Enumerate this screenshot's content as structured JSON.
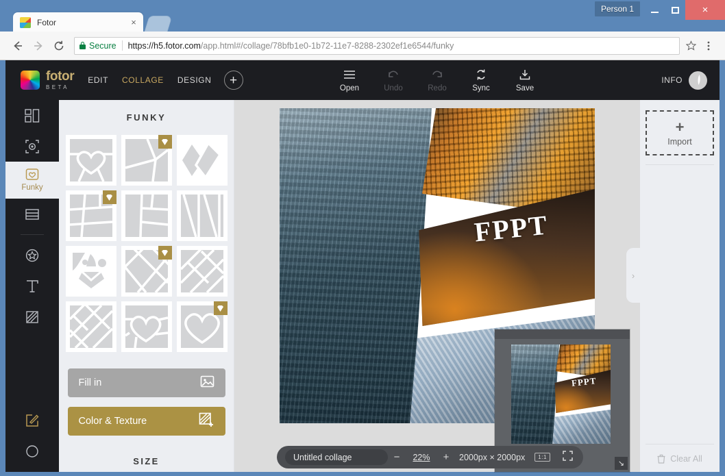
{
  "window": {
    "person_label": "Person 1",
    "minimize_icon": "minimize-icon",
    "maximize_icon": "maximize-icon",
    "close_label": "×"
  },
  "browser": {
    "tab": {
      "title": "Fotor",
      "close_label": "×",
      "favicon": "fotor-favicon"
    },
    "new_tab_name": "new-tab-button",
    "back_icon": "back-arrow-icon",
    "forward_icon": "forward-arrow-icon",
    "reload_icon": "reload-icon",
    "security_label": "Secure",
    "url_host": "https://h5.fotor.com",
    "url_path": "/app.html#/collage/78bfb1e0-1b72-11e7-8288-2302ef1e6544/funky",
    "url_full": "https://h5.fotor.com/app.html#/collage/78bfb1e0-1b72-11e7-8288-2302ef1e6544/funky",
    "star_icon": "bookmark-star-icon",
    "menu_icon": "chrome-menu-icon"
  },
  "app_header": {
    "brand_name": "fotor",
    "brand_beta": "BETA",
    "nav": [
      {
        "label": "EDIT",
        "active": false
      },
      {
        "label": "COLLAGE",
        "active": true
      },
      {
        "label": "DESIGN",
        "active": false
      }
    ],
    "add_button_label": "+",
    "tools": [
      {
        "label": "Open",
        "icon": "hamburger-icon",
        "disabled": false
      },
      {
        "label": "Undo",
        "icon": "undo-arrow-icon",
        "disabled": true
      },
      {
        "label": "Redo",
        "icon": "redo-arrow-icon",
        "disabled": true
      },
      {
        "label": "Sync",
        "icon": "sync-icon",
        "disabled": false
      },
      {
        "label": "Save",
        "icon": "save-download-icon",
        "disabled": false
      }
    ],
    "info_label": "INFO",
    "avatar_name": "user-avatar"
  },
  "rail": {
    "items": [
      {
        "name": "sidebar-item-layout",
        "icon": "layout-grid-icon",
        "label": "",
        "active": false
      },
      {
        "name": "sidebar-item-focus",
        "icon": "focus-target-icon",
        "label": "",
        "active": false
      },
      {
        "name": "sidebar-item-funky",
        "icon": "heart-badge-icon",
        "label": "Funky",
        "active": true
      },
      {
        "name": "sidebar-item-stripes",
        "icon": "rows-icon",
        "label": "",
        "active": false
      },
      {
        "name": "sidebar-item-sticker",
        "icon": "star-badge-icon",
        "label": "",
        "active": false
      },
      {
        "name": "sidebar-item-text",
        "icon": "text-t-icon",
        "label": "",
        "active": false
      },
      {
        "name": "sidebar-item-texture",
        "icon": "texture-diagonal-icon",
        "label": "",
        "active": false
      }
    ],
    "bottom_items": [
      {
        "name": "sidebar-item-edit-note",
        "icon": "pencil-square-icon"
      },
      {
        "name": "sidebar-item-contrast",
        "icon": "contrast-circle-icon"
      }
    ]
  },
  "panel": {
    "title": "FUNKY",
    "templates": [
      {
        "id": 1,
        "name": "template-heart-quad",
        "premium": false
      },
      {
        "id": 2,
        "name": "template-radial-split",
        "premium": true
      },
      {
        "id": 3,
        "name": "template-double-diamond",
        "premium": false
      },
      {
        "id": 4,
        "name": "template-skewed-grid",
        "premium": true
      },
      {
        "id": 5,
        "name": "template-vertical-blocks",
        "premium": false
      },
      {
        "id": 6,
        "name": "template-zigzag-strips",
        "premium": false
      },
      {
        "id": 7,
        "name": "template-abstract-face",
        "premium": false
      },
      {
        "id": 8,
        "name": "template-diamond-lattice",
        "premium": true
      },
      {
        "id": 9,
        "name": "template-diamond-corner",
        "premium": false
      },
      {
        "id": 10,
        "name": "template-diagonal-mosaic",
        "premium": false
      },
      {
        "id": 11,
        "name": "template-heart-outline-fill",
        "premium": false
      },
      {
        "id": 12,
        "name": "template-big-heart",
        "premium": true
      }
    ],
    "fill_in_label": "Fill in",
    "fill_in_icon": "picture-icon",
    "color_texture_label": "Color & Texture",
    "color_texture_icon": "texture-plus-icon",
    "size_label": "SIZE"
  },
  "canvas": {
    "collage_watermark": "FPPT",
    "collapse_handle_icon": "chevron-right-icon",
    "tiles": [
      {
        "name": "collage-tile-city-street",
        "style": "ph-city"
      },
      {
        "name": "collage-tile-orange-towers",
        "style": "ph-orange"
      },
      {
        "name": "collage-tile-church-dusk",
        "style": "ph-dusk"
      },
      {
        "name": "collage-tile-glass-roof",
        "style": "ph-glass"
      }
    ]
  },
  "zoombar": {
    "collage_name": "Untitled collage",
    "zoom_out_label": "−",
    "zoom_value": "22%",
    "zoom_in_label": "+",
    "dimensions": "2000px × 2000px",
    "one_to_one_label": "1:1",
    "fullscreen_icon": "fullscreen-icon"
  },
  "right_panel": {
    "import_plus": "+",
    "import_label": "Import",
    "clear_all_label": "Clear All",
    "clear_all_icon": "trash-icon"
  },
  "preview": {
    "name": "collage-preview-overlay",
    "watermark": "FPPT",
    "resize_icon": "resize-handle-icon"
  },
  "colors": {
    "window_blue": "#5b87b8",
    "app_dark": "#1c1d21",
    "panel_bg": "#eceef2",
    "accent_gold": "#ab9244",
    "canvas_bg": "#dcdcdc",
    "close_red": "#e06b6b",
    "secure_green": "#0b8043"
  }
}
